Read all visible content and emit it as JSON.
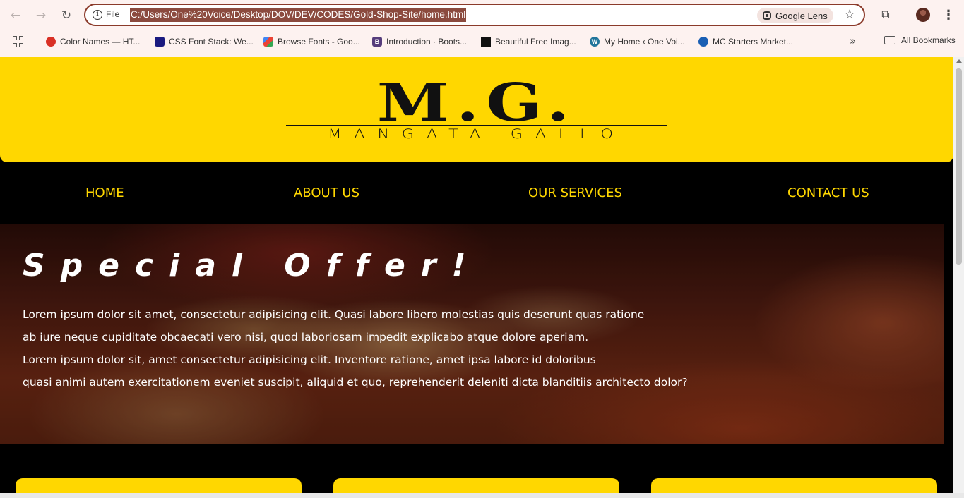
{
  "browser": {
    "back_icon": "arrow-left-icon",
    "forward_icon": "arrow-right-icon",
    "reload_icon": "reload-icon",
    "site_info_label": "File",
    "url": "C:/Users/One%20Voice/Desktop/DOV/DEV/CODES/Gold-Shop-Site/home.html",
    "lens_label": "Google Lens",
    "bookmarks": [
      {
        "label": "Color Names — HT...",
        "icon": "color-names-favicon",
        "color": "#d93025"
      },
      {
        "label": "CSS Font Stack: We...",
        "icon": "css-font-stack-favicon",
        "color": "#1a1a80"
      },
      {
        "label": "Browse Fonts - Goo...",
        "icon": "google-fonts-favicon",
        "color": "#4285f4"
      },
      {
        "label": "Introduction · Boots...",
        "icon": "bootstrap-favicon",
        "color": "#563d7c"
      },
      {
        "label": "Beautiful Free Imag...",
        "icon": "unsplash-favicon",
        "color": "#111111"
      },
      {
        "label": "My Home ‹ One Voi...",
        "icon": "wordpress-favicon",
        "color": "#21759b"
      },
      {
        "label": "MC Starters Market...",
        "icon": "mc-favicon",
        "color": "#1a5fb4"
      }
    ],
    "all_bookmarks_label": "All Bookmarks"
  },
  "site": {
    "colors": {
      "gold": "#ffd700",
      "black": "#000000",
      "white": "#ffffff"
    },
    "logo": {
      "main": "M.G.",
      "sub": "MANGATA GALLO"
    },
    "nav": [
      "HOME",
      "ABOUT US",
      "OUR SERVICES",
      "CONTACT US"
    ],
    "hero": {
      "title": "Special Offer!",
      "lines": [
        "Lorem ipsum dolor sit amet, consectetur adipisicing elit. Quasi labore libero molestias quis deserunt quas ratione",
        "ab iure neque cupiditate obcaecati vero nisi, quod laboriosam impedit explicabo atque dolore aperiam.",
        "Lorem ipsum dolor sit, amet consectetur adipisicing elit. Inventore ratione, amet ipsa labore id doloribus",
        "quasi animi autem exercitationem eveniet suscipit, aliquid et quo, reprehenderit deleniti dicta blanditiis architecto dolor?"
      ]
    }
  }
}
